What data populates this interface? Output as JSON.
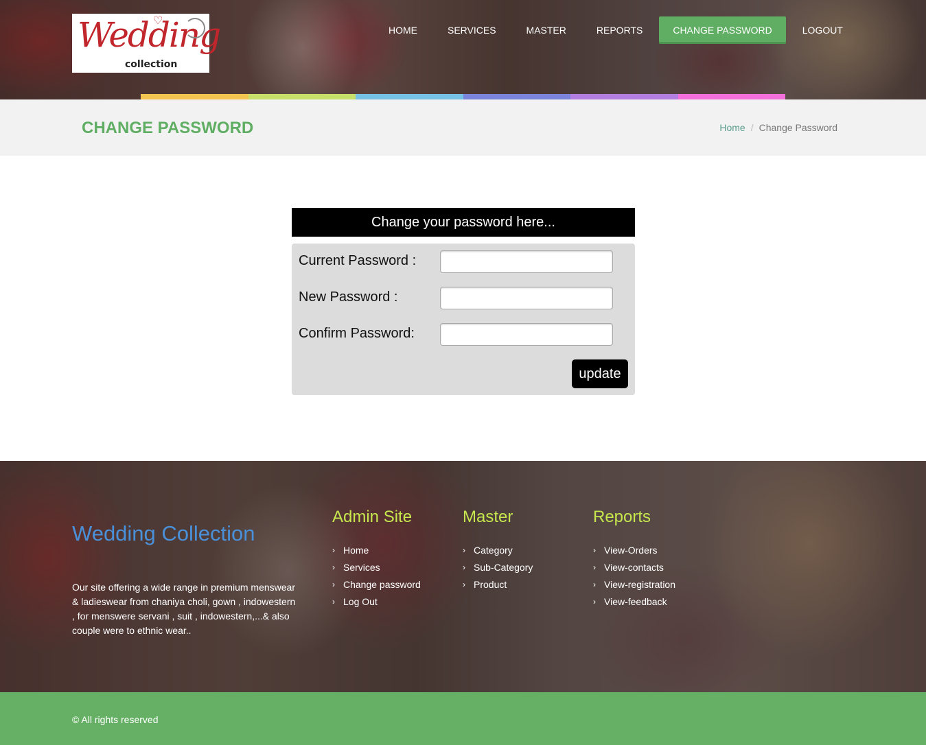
{
  "brand": {
    "logo_script": "Wedding",
    "logo_sub": "collection"
  },
  "nav": {
    "items": [
      {
        "label": "HOME"
      },
      {
        "label": "SERVICES"
      },
      {
        "label": "MASTER"
      },
      {
        "label": "REPORTS"
      },
      {
        "label": "CHANGE PASSWORD"
      },
      {
        "label": "LOGOUT"
      }
    ],
    "active_index": 4,
    "active_color": "#5fae63"
  },
  "rainbow_colors": [
    "#f3c44f",
    "#c6e06a",
    "#76c2e4",
    "#7b84db",
    "#b27fe0",
    "#f36fd9"
  ],
  "page": {
    "title": "CHANGE PASSWORD",
    "breadcrumb_home": "Home",
    "breadcrumb_sep": "/",
    "breadcrumb_current": "Change Password"
  },
  "form": {
    "heading": "Change your password here...",
    "fields": [
      {
        "label": "Current Password :",
        "value": ""
      },
      {
        "label": "New Password :",
        "value": ""
      },
      {
        "label": "Confirm Password:",
        "value": ""
      }
    ],
    "submit_label": "update"
  },
  "footer": {
    "brand": "Wedding Collection",
    "about": "Our site offering a wide range in premium menswear & ladieswear from chaniya choli, gown , indowestern , for menswere servani , suit , indowestern,...& also couple were to ethnic wear..",
    "columns": [
      {
        "title": "Admin Site",
        "links": [
          "Home",
          "Services",
          "Change password",
          "Log Out"
        ]
      },
      {
        "title": "Master",
        "links": [
          "Category",
          "Sub-Category",
          "Product"
        ]
      },
      {
        "title": "Reports",
        "links": [
          "View-Orders",
          "View-contacts",
          "View-registration",
          "View-feedback"
        ]
      }
    ],
    "heading_color": "#c6e74d",
    "copyright": "© All rights reserved"
  }
}
